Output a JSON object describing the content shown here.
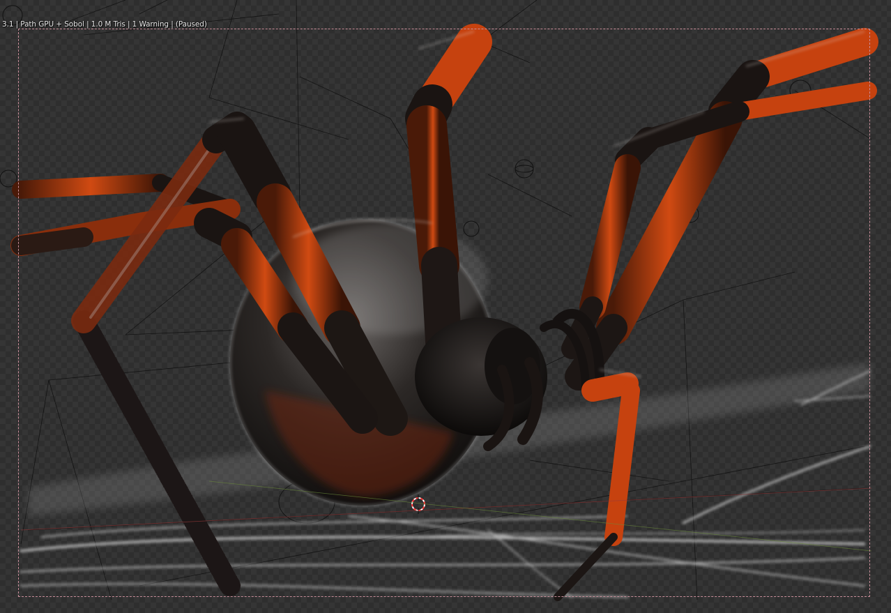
{
  "viewport": {
    "render_status": "3.1 | Path GPU + Sobol | 1.0 M Tris | 1 Warning | (Paused)"
  },
  "colors": {
    "leg_orange": "#c6420f",
    "leg_dark": "#1a1412",
    "body_dark": "#2a2624",
    "web_white": "#dcdcdc",
    "camera_frame": "#c98e9a",
    "wireframe": "#111111",
    "origin_cursor": "#ff4040"
  }
}
